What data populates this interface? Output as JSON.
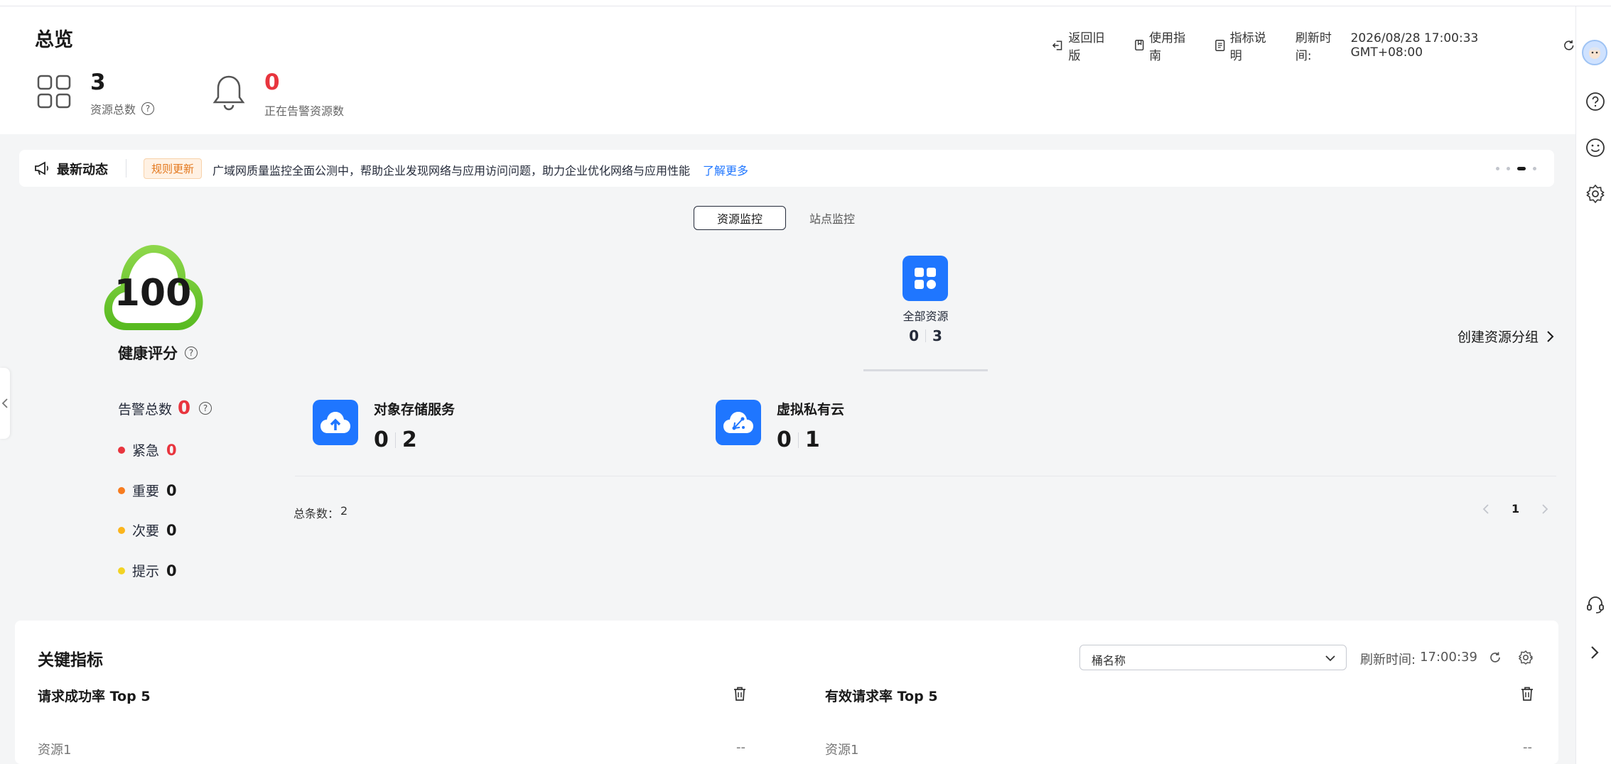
{
  "header": {
    "title": "总览",
    "toolbar": {
      "back_old_label": "返回旧版",
      "guide_label": "使用指南",
      "metrics_desc_label": "指标说明",
      "refresh_prefix": "刷新时间:",
      "refresh_time": "2026/08/28 17:00:33 GMT+08:00"
    },
    "stats": {
      "total_resources": "3",
      "total_resources_label": "资源总数",
      "alarming_resources": "0",
      "alarming_resources_label": "正在告警资源数"
    }
  },
  "news": {
    "title": "最新动态",
    "tag": "规则更新",
    "text": "广域网质量监控全面公测中，帮助企业发现网络与应用访问问题，助力企业优化网络与应用性能",
    "link": "了解更多"
  },
  "tabs": [
    "资源监控",
    "站点监控"
  ],
  "health": {
    "score": "100",
    "label": "健康评分",
    "alarm_total_label": "告警总数",
    "alarm_total": "0",
    "levels": [
      {
        "label": "紧急",
        "value": "0"
      },
      {
        "label": "重要",
        "value": "0"
      },
      {
        "label": "次要",
        "value": "0"
      },
      {
        "label": "提示",
        "value": "0"
      }
    ],
    "colors": {
      "score_ring": "#6cc63a",
      "urgent": "#e8353e",
      "major": "#f77c1f",
      "minor": "#fbb51d",
      "info": "#f2d324"
    }
  },
  "resources": {
    "all": {
      "label": "全部资源",
      "alarm": "0",
      "total": "3"
    },
    "create_group_label": "创建资源分组",
    "items": [
      {
        "name": "对象存储服务",
        "alarm": "0",
        "total": "2",
        "icon": "cloud-upload-icon"
      },
      {
        "name": "虚拟私有云",
        "alarm": "0",
        "total": "1",
        "icon": "vpc-cloud-icon"
      }
    ],
    "total_label": "总条数：",
    "total_count": "2",
    "page": "1"
  },
  "key_metrics": {
    "title": "关键指标",
    "select_placeholder": "桶名称",
    "refresh_prefix": "刷新时间:",
    "refresh_time": "17:00:39",
    "panels": [
      {
        "title": "请求成功率 Top 5",
        "row_label": "资源1",
        "row_value": "--"
      },
      {
        "title": "有效请求率 Top 5",
        "row_label": "资源1",
        "row_value": "--"
      }
    ]
  },
  "accent_color": "#1f76ff",
  "alarm_color": "#e8353e"
}
